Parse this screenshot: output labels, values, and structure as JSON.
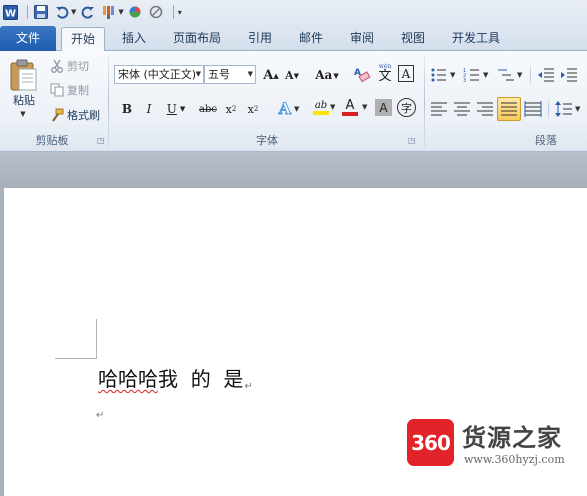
{
  "quick_access": {
    "icons": [
      "word-app-icon",
      "save-icon",
      "undo-icon",
      "redo-icon",
      "format-painter-icon",
      "color-icon",
      "clear-format-icon",
      "customize-dropdown-icon"
    ]
  },
  "tabs": {
    "file": "文件",
    "home": "开始",
    "insert": "插入",
    "page_layout": "页面布局",
    "references": "引用",
    "mailings": "邮件",
    "review": "审阅",
    "view": "视图",
    "developer": "开发工具"
  },
  "clipboard": {
    "paste": "粘贴",
    "cut": "剪切",
    "copy": "复制",
    "format_painter": "格式刷",
    "group_label": "剪贴板"
  },
  "font": {
    "font_name": "宋体 (中文正文)",
    "font_size": "五号",
    "group_label": "字体",
    "change_case": "Aa",
    "grow": "A",
    "shrink": "A",
    "bold": "B",
    "italic": "I",
    "underline": "U",
    "strikethrough": "abc",
    "subscript": "x",
    "superscript": "x",
    "sub_mark": "2",
    "sup_mark": "2",
    "text_effects": "A",
    "highlight": "ab",
    "font_color": "A",
    "char_shading": "A",
    "enclose": "字",
    "phonetic_top": "wén",
    "phonetic": "文",
    "border": "A",
    "colors": {
      "highlight": "#ffe600",
      "font_color": "#d9201e",
      "effects": "#4f9be0"
    }
  },
  "paragraph": {
    "group_label": "段落"
  },
  "document": {
    "line1_a": "哈哈哈",
    "line1_b": "我  的  是",
    "paragraph_mark": "↵"
  },
  "watermark": {
    "logo": "360",
    "title": "货源之家",
    "url": "www.360hyzj.com"
  }
}
